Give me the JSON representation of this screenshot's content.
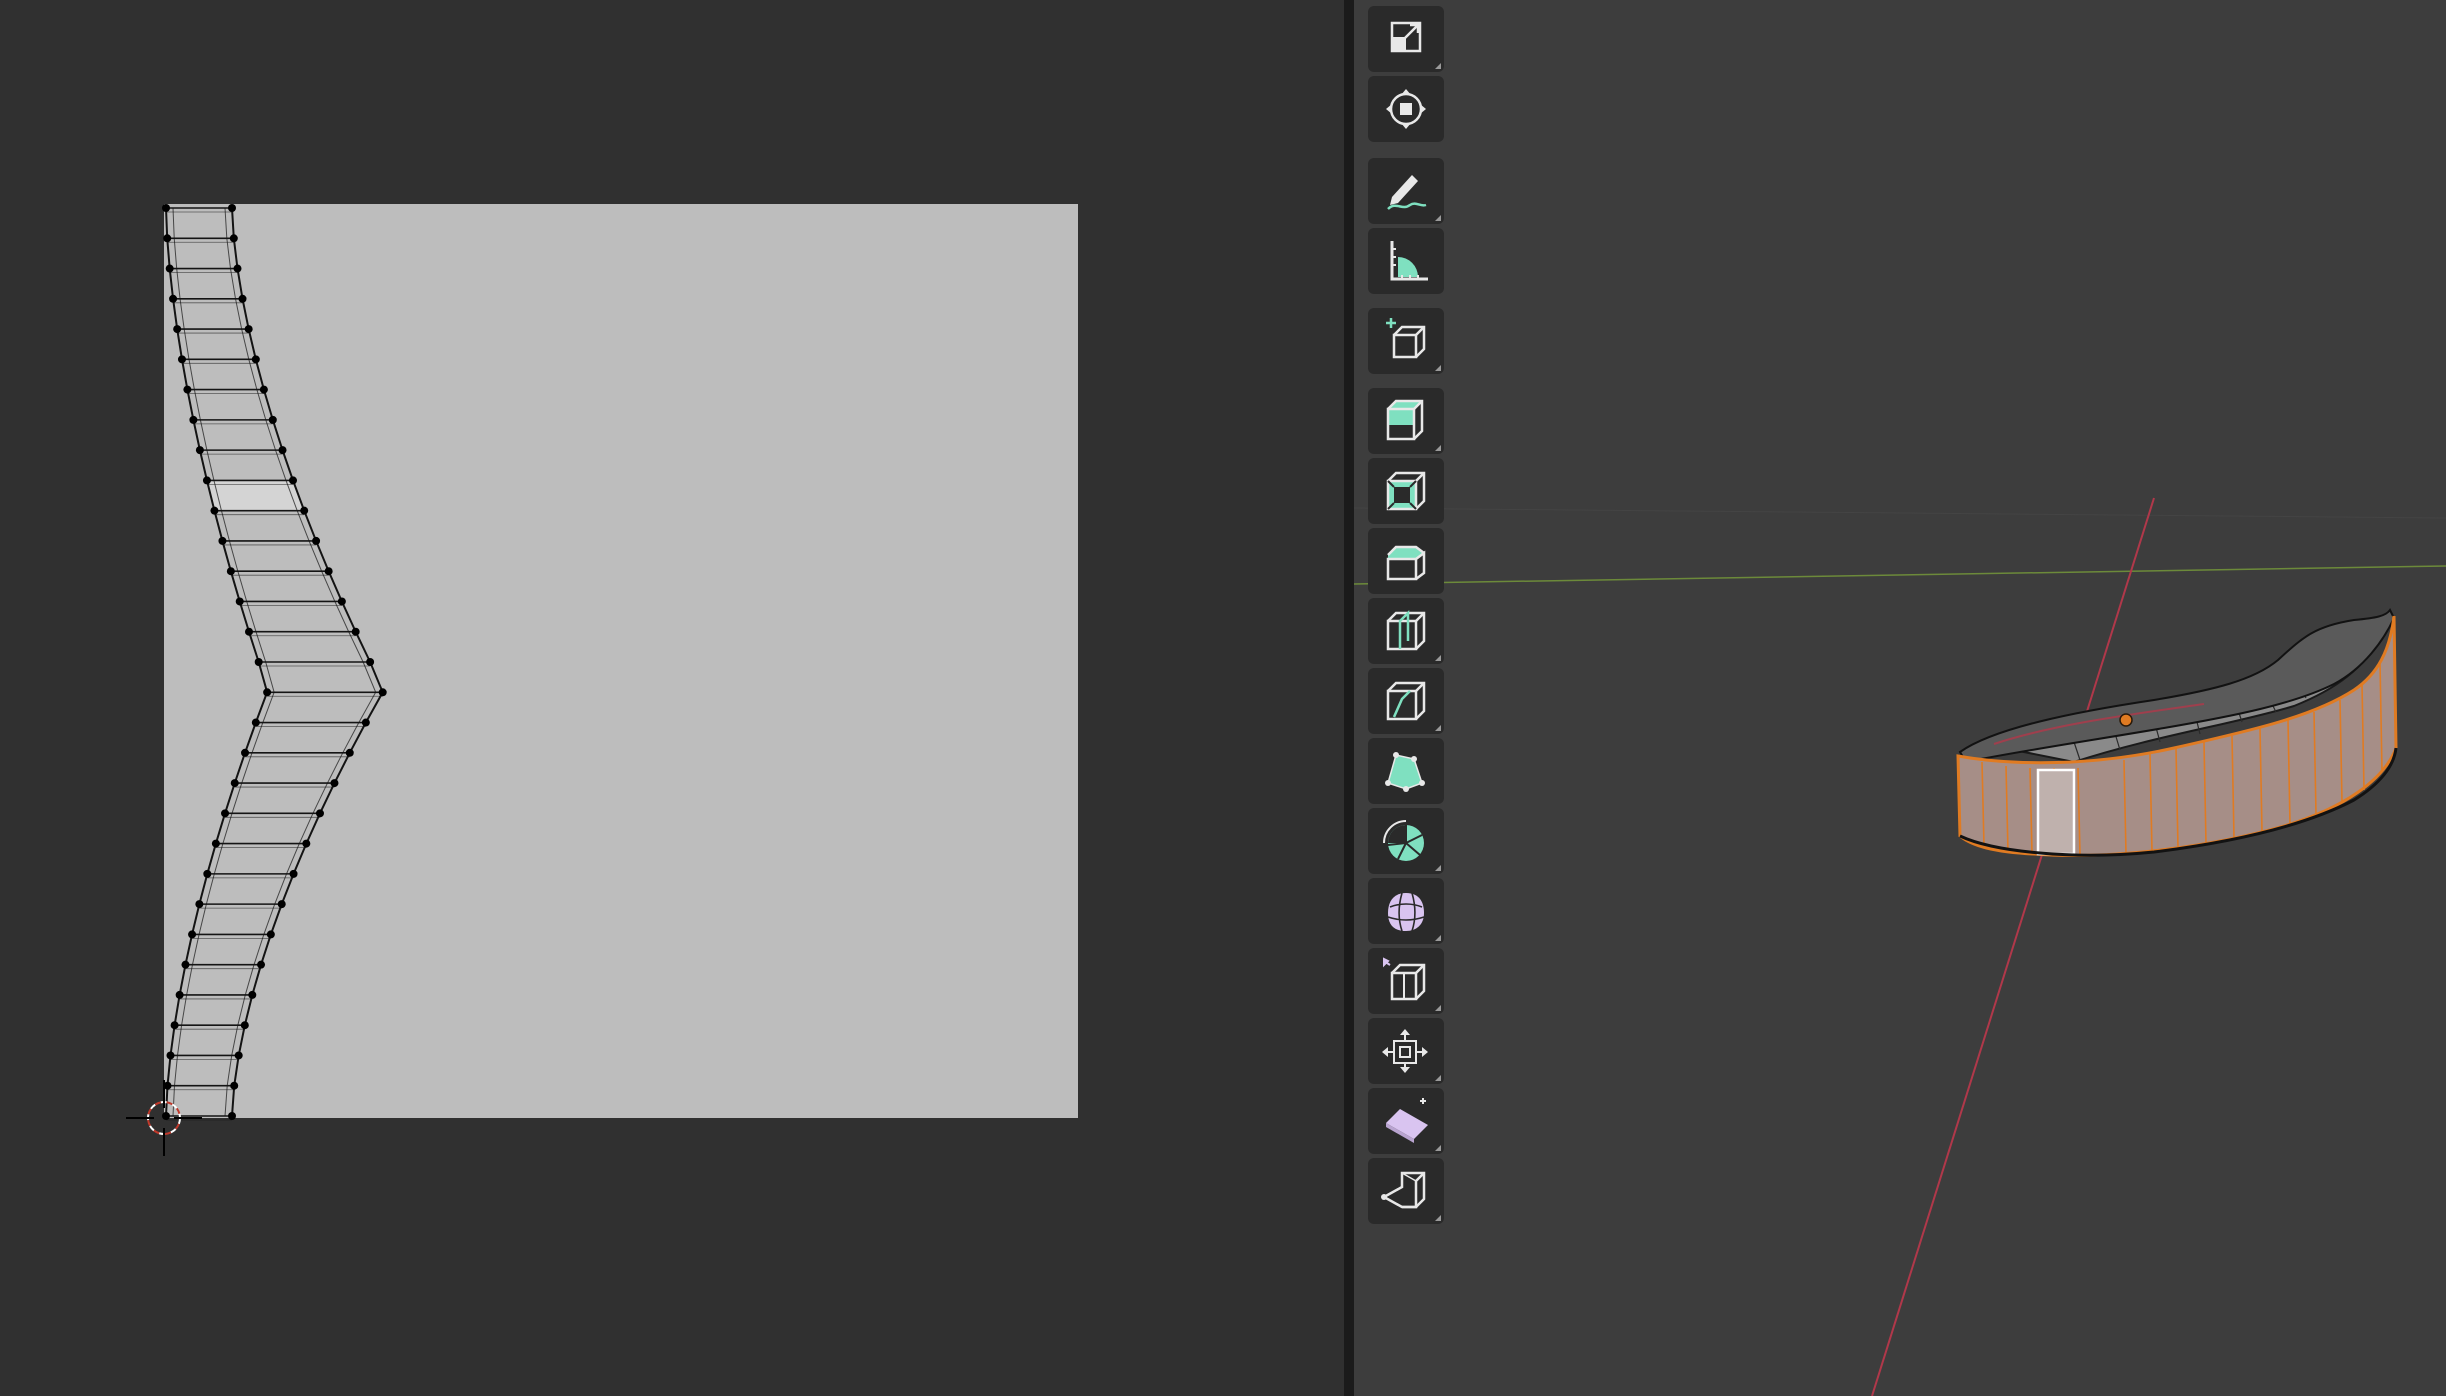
{
  "uv_editor": {
    "background": "#303030",
    "texture_fill": "#bdbdbd",
    "mesh_wire": "#141414",
    "selected_face_fill": "#d4d4d4"
  },
  "viewport": {
    "background": "#3d3d3d",
    "x_axis_color": "#b0384a",
    "y_axis_color": "#6c8a3a",
    "selection_outline": "#e07b22",
    "active_face_outline": "#ffffff"
  },
  "toolbar": {
    "tools": [
      {
        "id": "scale",
        "icon": "scale-icon",
        "has_submenu": true
      },
      {
        "id": "transform",
        "icon": "transform-icon",
        "has_submenu": false
      },
      {
        "id": "annotate",
        "icon": "annotate-icon",
        "has_submenu": true
      },
      {
        "id": "measure",
        "icon": "measure-icon",
        "has_submenu": false
      },
      {
        "id": "add-cube",
        "icon": "add-cube-icon",
        "has_submenu": true
      },
      {
        "id": "extrude-region",
        "icon": "extrude-region-icon",
        "has_submenu": true
      },
      {
        "id": "inset-faces",
        "icon": "inset-faces-icon",
        "has_submenu": false
      },
      {
        "id": "bevel",
        "icon": "bevel-icon",
        "has_submenu": false
      },
      {
        "id": "loop-cut",
        "icon": "loop-cut-icon",
        "has_submenu": true
      },
      {
        "id": "knife",
        "icon": "knife-icon",
        "has_submenu": true
      },
      {
        "id": "poly-build",
        "icon": "poly-build-icon",
        "has_submenu": false
      },
      {
        "id": "spin",
        "icon": "spin-icon",
        "has_submenu": true
      },
      {
        "id": "smooth",
        "icon": "smooth-icon",
        "has_submenu": true
      },
      {
        "id": "edge-slide",
        "icon": "edge-slide-icon",
        "has_submenu": true
      },
      {
        "id": "shrink-fatten",
        "icon": "shrink-fatten-icon",
        "has_submenu": true
      },
      {
        "id": "shear",
        "icon": "shear-icon",
        "has_submenu": true
      },
      {
        "id": "rip-region",
        "icon": "rip-region-icon",
        "has_submenu": true
      }
    ]
  }
}
